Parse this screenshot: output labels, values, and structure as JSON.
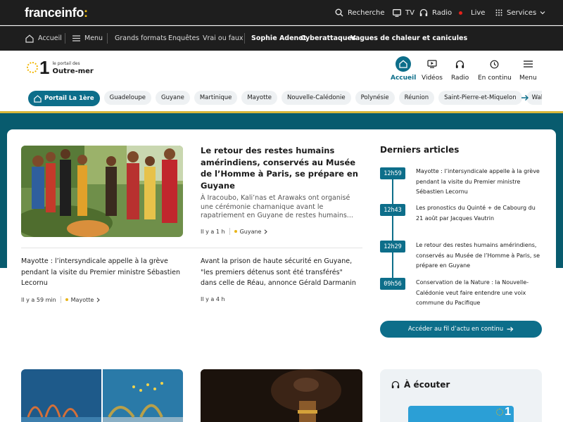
{
  "topbar": {
    "logo": "franceinfo",
    "logo_colon": ":",
    "search_label": "Recherche",
    "tv_label": "TV",
    "radio_label": "Radio",
    "live_label": "Live",
    "services_label": "Services"
  },
  "navbar2": {
    "home_label": "Accueil",
    "menu_label": "Menu",
    "links": [
      "Grands formats",
      "Enquêtes",
      "Vrai ou faux"
    ],
    "trending": [
      "Sophie Adenot",
      "Cyberattaques",
      "Vagues de chaleur et canicules"
    ]
  },
  "portal": {
    "logo_number": "1",
    "logo_small": "le portail des",
    "logo_big": "Outre-mer",
    "nav": [
      {
        "label": "Accueil",
        "icon": "home-icon"
      },
      {
        "label": "Vidéos",
        "icon": "video-icon"
      },
      {
        "label": "Radio",
        "icon": "headphones-icon"
      },
      {
        "label": "En continu",
        "icon": "clock-icon"
      },
      {
        "label": "Menu",
        "icon": "menu-icon"
      }
    ],
    "chips": [
      "Portail La 1ère",
      "Guadeloupe",
      "Guyane",
      "Martinique",
      "Mayotte",
      "Nouvelle-Calédonie",
      "Polynésie",
      "Réunion",
      "Saint-Pierre-et-Miquelon",
      "Wallis-et-Futuna"
    ]
  },
  "hero": {
    "title": "Le retour des restes humains amérindiens, conservés au Musée de l’Homme à Paris, se prépare en Guyane",
    "description": "À Iracoubo, Kali’nas et Arawaks ont organisé une cérémonie chamanique avant le rapatriement en Guyane de restes humains...",
    "time": "Il y a 1 h",
    "tag": "Guyane"
  },
  "secondary": [
    {
      "title": "Mayotte : l’intersyndicale appelle à la grève pendant la visite du Premier ministre Sébastien Lecornu",
      "time": "Il y a 59 min",
      "tag": "Mayotte"
    },
    {
      "title": "Avant la prison de haute sécurité en Guyane, \"les premiers détenus sont été transférés\" dans celle de Réau, annonce Gérald Darmanin",
      "time": "Il y a 4 h"
    }
  ],
  "latest": {
    "heading": "Derniers articles",
    "items": [
      {
        "time": "12h59",
        "text": "Mayotte : l’intersyndicale appelle à la grève pendant la visite du Premier ministre Sébastien Lecornu"
      },
      {
        "time": "12h43",
        "text": "Les pronostics du Quinté + de Cabourg du 21 août par Jacques Vautrin"
      },
      {
        "time": "12h29",
        "text": "Le retour des restes humains amérindiens, conservés au Musée de l’Homme à Paris, se prépare en Guyane"
      },
      {
        "time": "09h56",
        "text": "Conservation de la Nature : la Nouvelle-Calédonie veut faire entendre une voix commune du Pacifique"
      }
    ],
    "button": "Accéder au fil d’actu en continu"
  },
  "listen": {
    "heading": "À écouter",
    "logo_number": "1"
  },
  "colors": {
    "teal": "#085b6e",
    "accent": "#0d6e8a",
    "gold": "#d9b73a",
    "topbar": "#1e1e1e"
  }
}
